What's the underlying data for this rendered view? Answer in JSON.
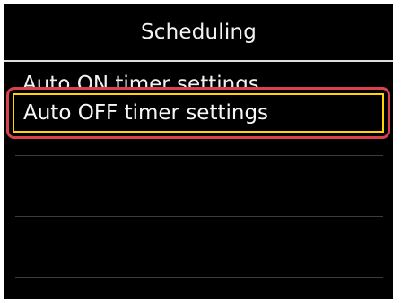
{
  "title": "Scheduling",
  "menu": {
    "items": [
      {
        "label": "Auto ON timer settings"
      },
      {
        "label": "Auto OFF timer settings",
        "selected": true
      }
    ]
  },
  "colors": {
    "background": "#000000",
    "text": "#f2f2f2",
    "selection_outer": "#d9414f",
    "selection_inner": "#ffd400"
  }
}
